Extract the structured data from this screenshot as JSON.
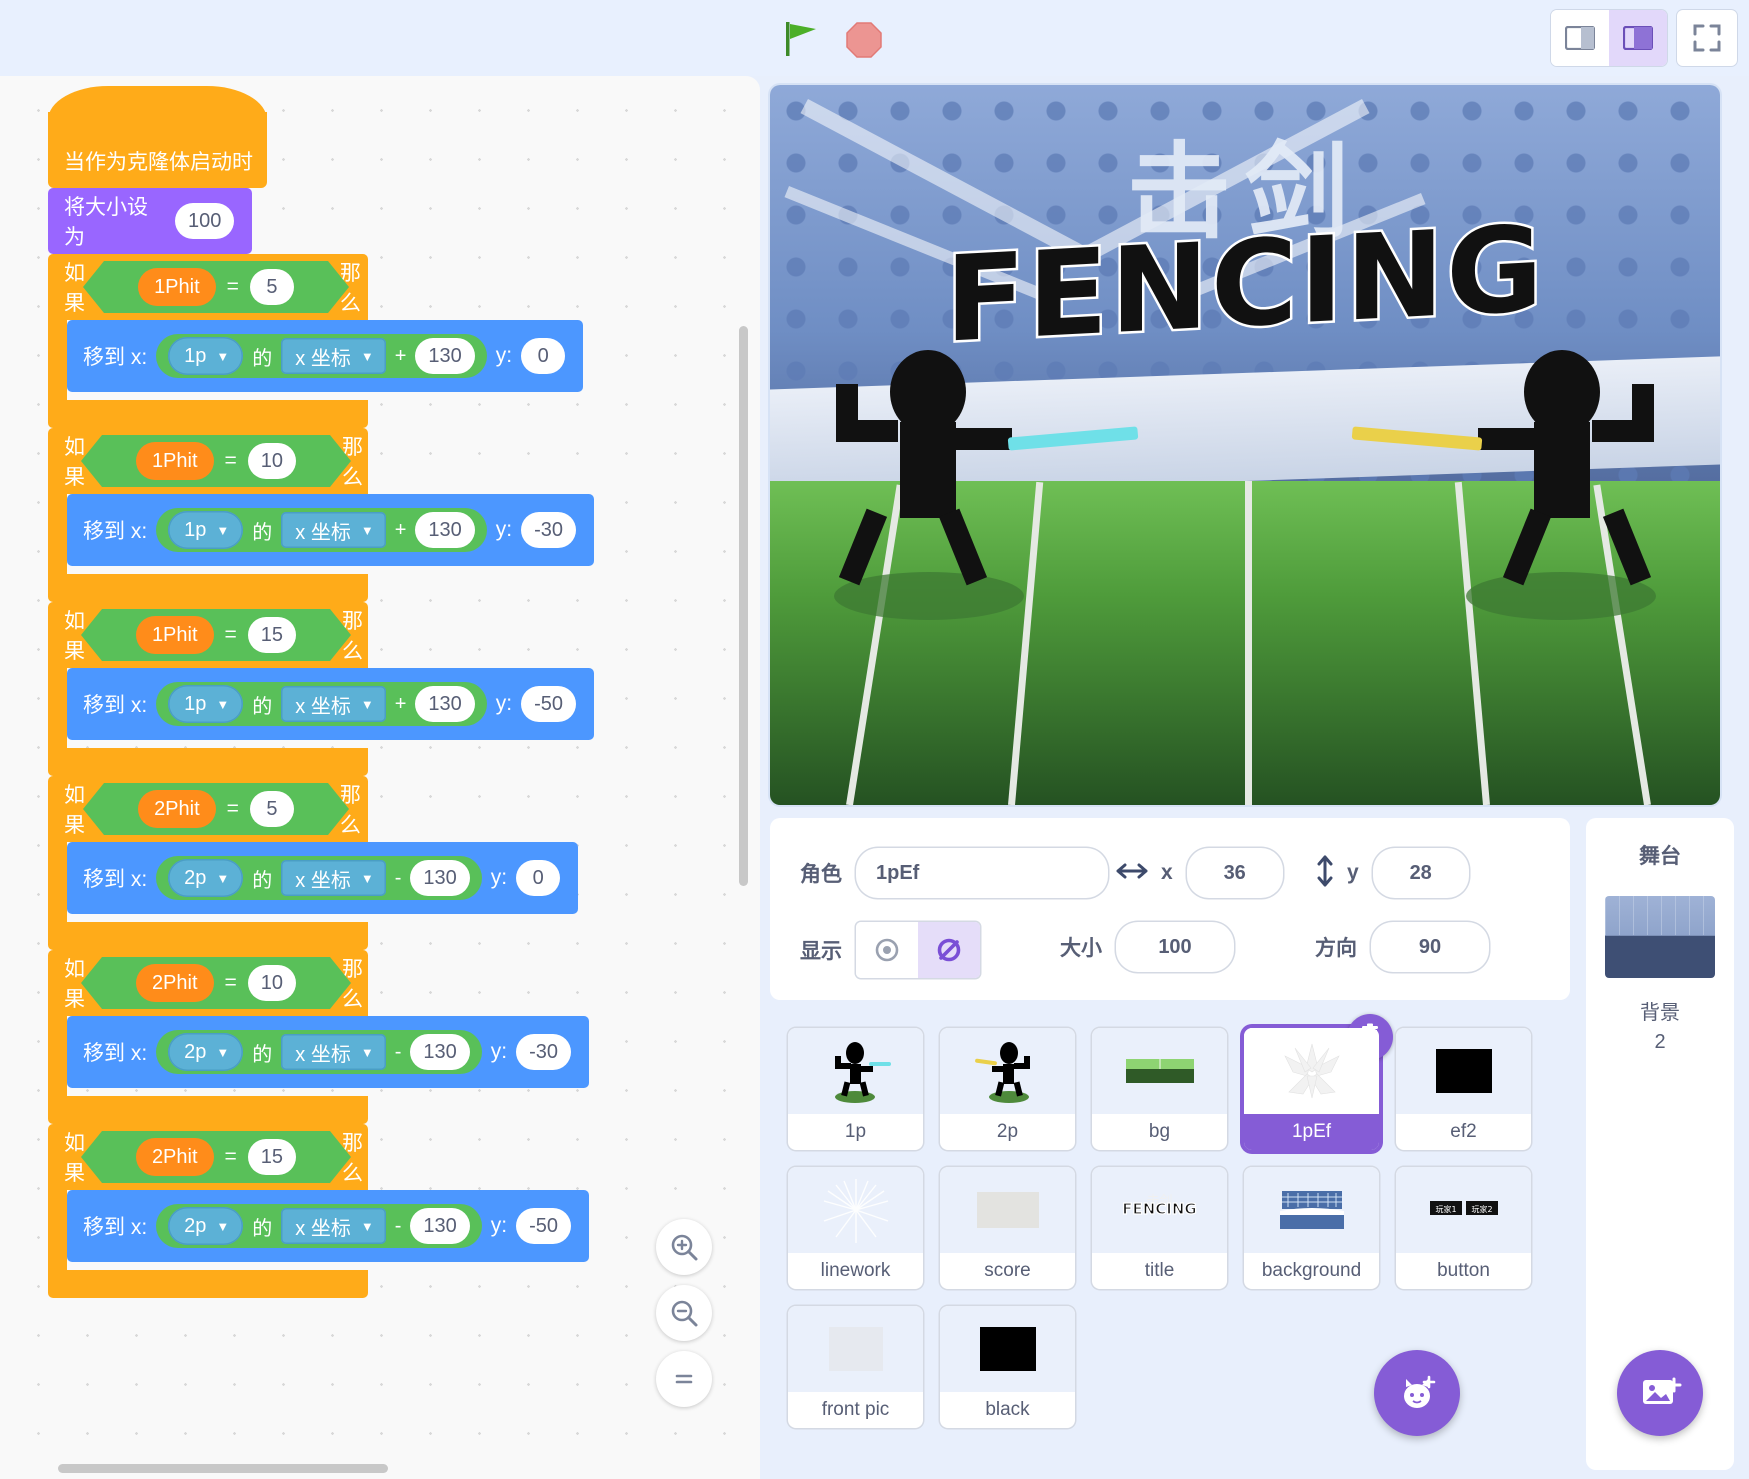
{
  "toolbar": {
    "green_flag_label": "绿旗",
    "stop_label": "停止",
    "layout_small_label": "小舞台",
    "layout_large_label": "大舞台",
    "fullscreen_label": "全屏"
  },
  "workspace": {
    "zoom_in": "+",
    "zoom_out": "−",
    "zoom_reset": "=",
    "scripts": [
      {
        "type": "hat",
        "label": "当作为克隆体启动时"
      },
      {
        "type": "looks",
        "label": "将大小设为",
        "value": "100"
      },
      {
        "type": "if",
        "cond_var": "1Phit",
        "operator": "=",
        "cond_value": "5",
        "then_label": "那么",
        "if_label": "如果",
        "body": {
          "label": "移到 x:",
          "sprite": "1p",
          "of": "的",
          "prop": "x 坐标",
          "op": "+",
          "offset": "130",
          "ylabel": "y:",
          "yvalue": "0"
        }
      },
      {
        "type": "if",
        "cond_var": "1Phit",
        "operator": "=",
        "cond_value": "10",
        "then_label": "那么",
        "if_label": "如果",
        "body": {
          "label": "移到 x:",
          "sprite": "1p",
          "of": "的",
          "prop": "x 坐标",
          "op": "+",
          "offset": "130",
          "ylabel": "y:",
          "yvalue": "-30"
        }
      },
      {
        "type": "if",
        "cond_var": "1Phit",
        "operator": "=",
        "cond_value": "15",
        "then_label": "那么",
        "if_label": "如果",
        "body": {
          "label": "移到 x:",
          "sprite": "1p",
          "of": "的",
          "prop": "x 坐标",
          "op": "+",
          "offset": "130",
          "ylabel": "y:",
          "yvalue": "-50"
        }
      },
      {
        "type": "if",
        "cond_var": "2Phit",
        "operator": "=",
        "cond_value": "5",
        "then_label": "那么",
        "if_label": "如果",
        "body": {
          "label": "移到 x:",
          "sprite": "2p",
          "of": "的",
          "prop": "x 坐标",
          "op": "-",
          "offset": "130",
          "ylabel": "y:",
          "yvalue": "0"
        }
      },
      {
        "type": "if",
        "cond_var": "2Phit",
        "operator": "=",
        "cond_value": "10",
        "then_label": "那么",
        "if_label": "如果",
        "body": {
          "label": "移到 x:",
          "sprite": "2p",
          "of": "的",
          "prop": "x 坐标",
          "op": "-",
          "offset": "130",
          "ylabel": "y:",
          "yvalue": "-30"
        }
      },
      {
        "type": "if",
        "cond_var": "2Phit",
        "operator": "=",
        "cond_value": "15",
        "then_label": "那么",
        "if_label": "如果",
        "body": {
          "label": "移到 x:",
          "sprite": "2p",
          "of": "的",
          "prop": "x 坐标",
          "op": "-",
          "offset": "130",
          "ylabel": "y:",
          "yvalue": "-50"
        }
      }
    ]
  },
  "stage": {
    "title_cn": "击剑",
    "title_en": "FENCING"
  },
  "sprite_info": {
    "name_label": "角色",
    "name_value": "1pEf",
    "x_label": "x",
    "x_value": "36",
    "y_label": "y",
    "y_value": "28",
    "show_label": "显示",
    "show_on_label": "显示",
    "show_off_label": "隐藏",
    "size_label": "大小",
    "size_value": "100",
    "direction_label": "方向",
    "direction_value": "90"
  },
  "sprites": [
    {
      "name": "1p",
      "kind": "fencer-blue"
    },
    {
      "name": "2p",
      "kind": "fencer-yellow"
    },
    {
      "name": "bg",
      "kind": "bg-strip"
    },
    {
      "name": "1pEf",
      "kind": "burst",
      "selected": true
    },
    {
      "name": "ef2",
      "kind": "black-square"
    },
    {
      "name": "linework",
      "kind": "linework"
    },
    {
      "name": "score",
      "kind": "gray-box"
    },
    {
      "name": "title",
      "kind": "title-art"
    },
    {
      "name": "background",
      "kind": "arena"
    },
    {
      "name": "button",
      "kind": "button-art"
    },
    {
      "name": "front pic",
      "kind": "light-box"
    },
    {
      "name": "black",
      "kind": "black-square"
    }
  ],
  "stage_pane": {
    "title": "舞台",
    "backdrop_label": "背景",
    "backdrop_count": "2",
    "add_backdrop_label": "选择一个背景"
  },
  "colors": {
    "accent_purple": "#855cd6",
    "control_orange": "#ffab19",
    "motion_blue": "#4c97ff",
    "looks_purple": "#9966ff",
    "operator_green": "#59c059",
    "variable_orange": "#ff8c1a",
    "sensing_blue": "#5cb1d6"
  }
}
